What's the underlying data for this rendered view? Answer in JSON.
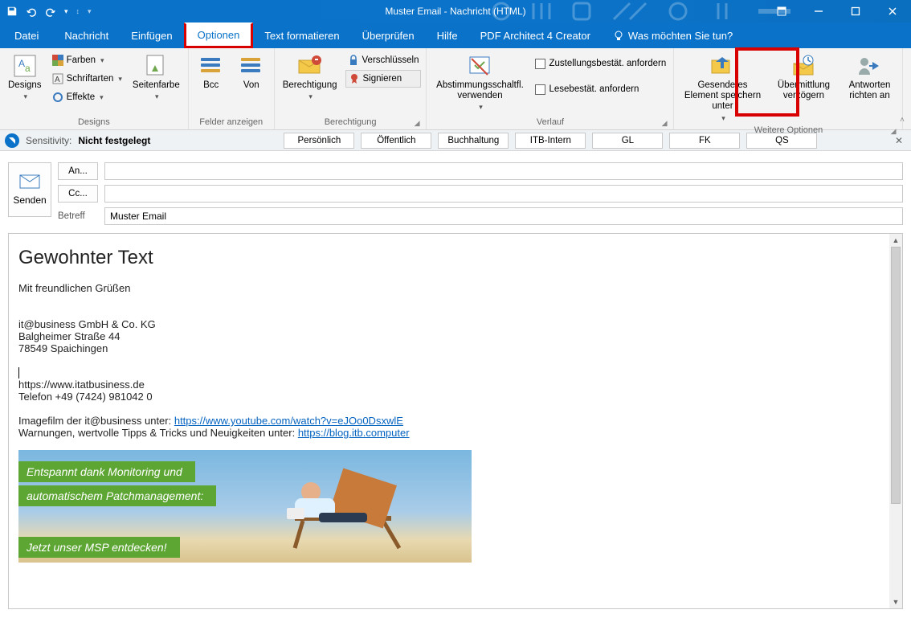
{
  "title": "Muster Email  -  Nachricht (HTML)",
  "menu": {
    "file": "Datei",
    "message": "Nachricht",
    "insert": "Einfügen",
    "options": "Optionen",
    "format": "Text formatieren",
    "review": "Überprüfen",
    "help": "Hilfe",
    "pdf": "PDF Architect 4 Creator",
    "tellme": "Was möchten Sie tun?"
  },
  "ribbon": {
    "designs": {
      "label": "Designs",
      "button": "Designs",
      "colors": "Farben",
      "fonts": "Schriftarten",
      "effects": "Effekte",
      "pagecolor": "Seitenfarbe"
    },
    "fields": {
      "label": "Felder anzeigen",
      "bcc": "Bcc",
      "from": "Von"
    },
    "perm": {
      "label": "Berechtigung",
      "button": "Berechtigung",
      "encrypt": "Verschlüsseln",
      "sign": "Signieren"
    },
    "tracking": {
      "label": "Verlauf",
      "voting": "Abstimmungsschaltfl. verwenden",
      "delivery": "Zustellungsbestät. anfordern",
      "read": "Lesebestät. anfordern"
    },
    "more": {
      "label": "Weitere Optionen",
      "saveto": "Gesendetes Element speichern unter",
      "delay": "Übermittlung verzögern",
      "direct": "Antworten richten an"
    }
  },
  "sensitivity": {
    "label": "Sensitivity:",
    "value": "Nicht festgelegt",
    "tabs": [
      "Persönlich",
      "Öffentlich",
      "Buchhaltung",
      "ITB-Intern",
      "GL",
      "FK",
      "QS"
    ]
  },
  "compose": {
    "send": "Senden",
    "to": "An...",
    "cc": "Cc...",
    "subject_label": "Betreff",
    "subject_value": "Muster Email"
  },
  "body": {
    "heading": "Gewohnter Text",
    "greeting": "Mit freundlichen Grüßen",
    "company": "it@business GmbH & Co. KG",
    "street": "Balgheimer Straße 44",
    "city": "78549 Spaichingen",
    "url": "https://www.itatbusiness.de",
    "phone": "Telefon +49 (7424) 981042 0",
    "imagefilm_prefix": "Imagefilm der it@business unter: ",
    "imagefilm_url": "https://www.youtube.com/watch?v=eJOo0DsxwlE",
    "tips_prefix": "Warnungen, wertvolle Tipps & Tricks und Neuigkeiten unter: ",
    "tips_url": "https://blog.itb.computer",
    "banner": {
      "line1": "Entspannt dank Monitoring und",
      "line2": "automatischem Patchmanagement:",
      "cta": "Jetzt unser MSP entdecken!"
    }
  }
}
